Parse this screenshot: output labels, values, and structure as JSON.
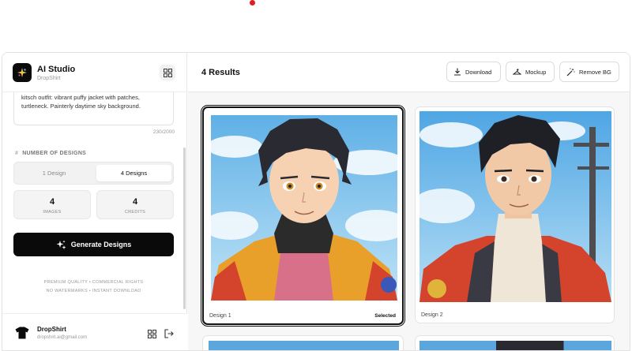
{
  "app": {
    "title": "AI Studio",
    "subtitle": "DropShirt"
  },
  "prompt": {
    "text": "kitsch outfit: vibrant puffy jacket with patches, turtleneck. Painterly daytime sky background.",
    "char_count": "230/2000"
  },
  "designs": {
    "section_label": "NUMBER OF DESIGNS",
    "options": [
      "1 Design",
      "4 Designs"
    ],
    "selected": "4 Designs"
  },
  "stats": [
    {
      "value": "4",
      "label": "IMAGES"
    },
    {
      "value": "4",
      "label": "CREDITS"
    }
  ],
  "generate_label": "Generate Designs",
  "fine_print": [
    "PREMIUM QUALITY • COMMERCIAL RIGHTS",
    "NO WATERMARKS • INSTANT DOWNLOAD"
  ],
  "user": {
    "name": "DropShirt",
    "email": "dropshirt.ai@gmail.com"
  },
  "results": {
    "title": "4 Results",
    "actions": {
      "download": "Download",
      "mockup": "Mockup",
      "remove_bg": "Remove BG"
    },
    "cards": [
      {
        "label": "Design 1",
        "badge": "Selected"
      },
      {
        "label": "Design 2"
      }
    ]
  },
  "colors": {
    "accent": "#0a0a0a",
    "sky": "#8cc8ee",
    "jacket_orange": "#e9a02a",
    "jacket_red": "#d4442c"
  }
}
